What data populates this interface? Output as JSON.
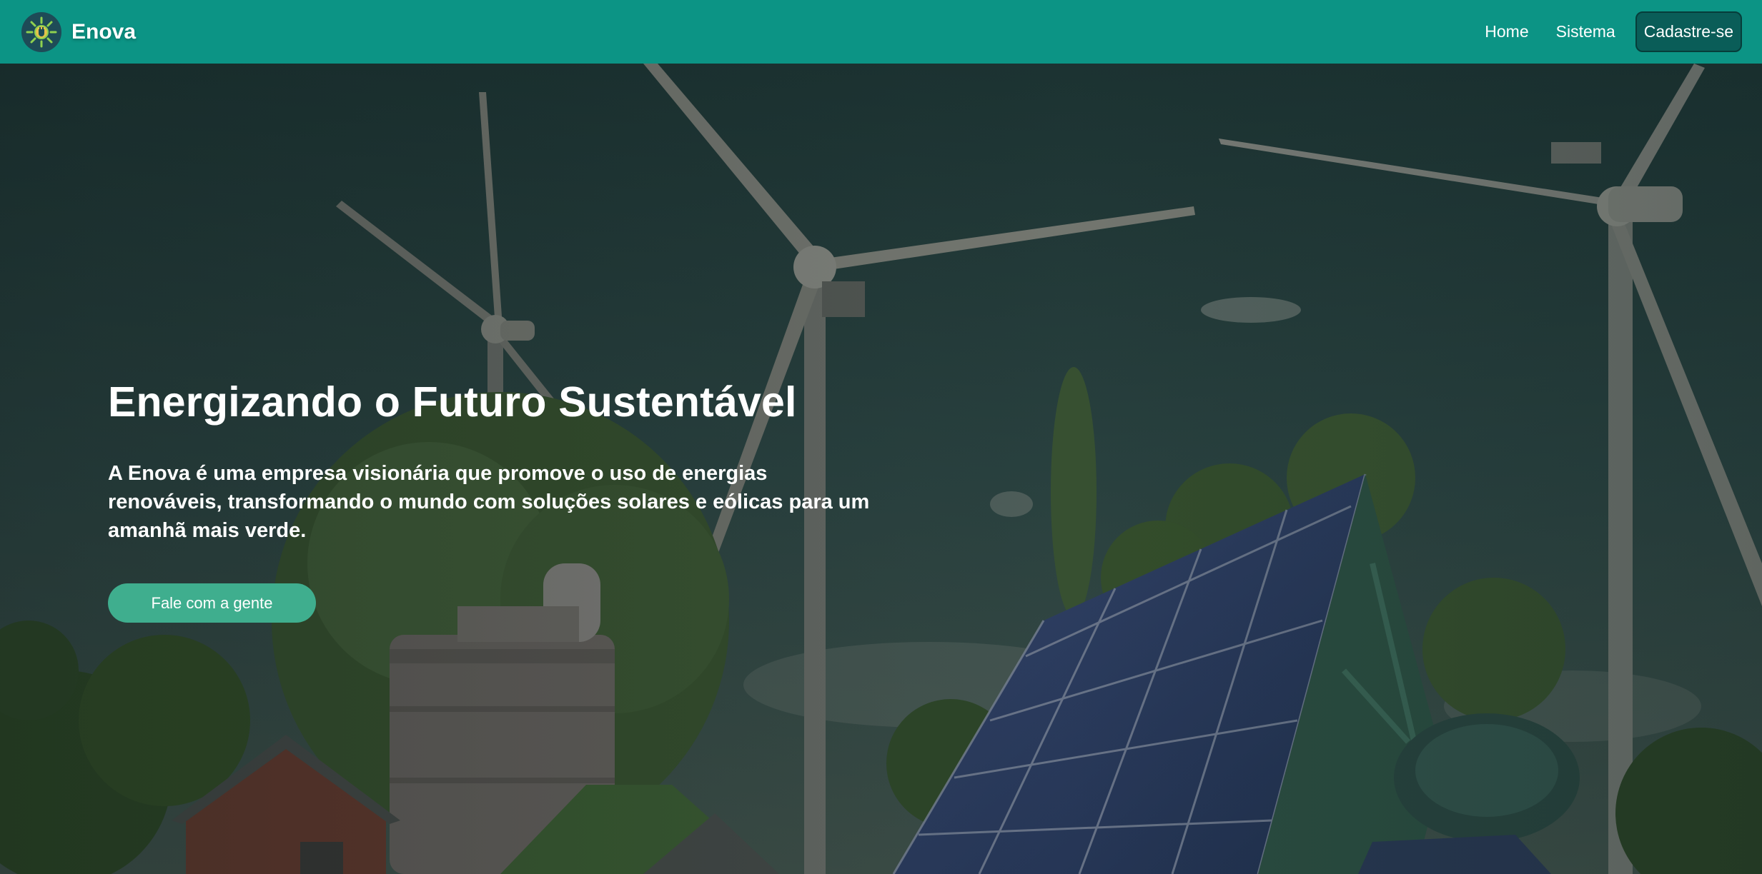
{
  "nav": {
    "brand": "Enova",
    "links": [
      "Home",
      "Sistema"
    ],
    "cta": "Cadastre-se"
  },
  "hero": {
    "title": "Energizando o Futuro Sustentável",
    "text": "A Enova é uma empresa visionária que promove o uso de energias renováveis, transformando o mundo com soluções solares e eólicas para um amanhã mais verde.",
    "button": "Fale com a gente"
  },
  "colors": {
    "navbar": "#0c9485",
    "cta_bg": "#0a5d58",
    "hero_button": "#3fae8e"
  },
  "icons": {
    "logo": "sun-gear-logo-icon"
  }
}
